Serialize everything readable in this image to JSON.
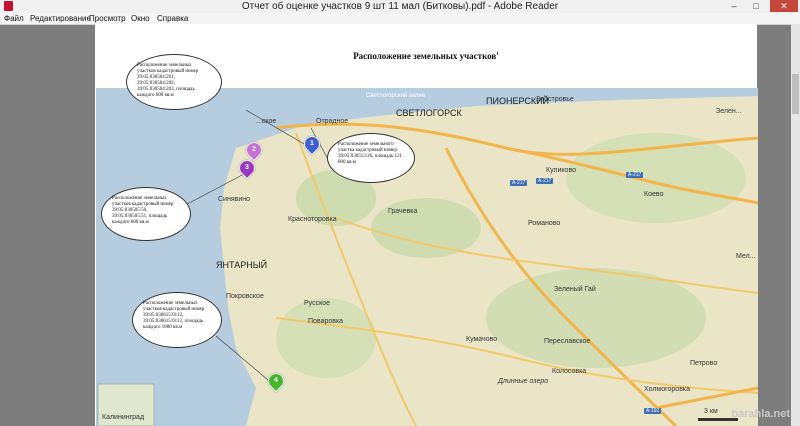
{
  "window": {
    "title": "Отчет об оценке участков 9 шт 11 мал (Битковы).pdf - Adobe Reader",
    "minimize": "–",
    "maximize": "□",
    "close": "✕"
  },
  "menu": [
    "Файл",
    "Редактирование",
    "Просмотр",
    "Окно",
    "Справка"
  ],
  "document": {
    "heading": "Расположение земельных участков",
    "footnote_mark": "1"
  },
  "map": {
    "places": {
      "svetlogorsk": "СВЕТЛОГОРСК",
      "pionersky": "ПИОНЕРСКИЙ",
      "yantarny": "ЯНТАРНЫЙ",
      "kulikovo": "Куликово",
      "koevo": "Коевo",
      "romanovo": "Романово",
      "krasnotorovka": "Красноторовка",
      "grachevka": "Грачевка",
      "sinyavino": "Синявино",
      "pokrovskoe": "Покровское",
      "russkoe": "Русское",
      "povarovka": "Поваровка",
      "zeleny_gay": "Зеленый Гай",
      "kumachovo": "Кумачово",
      "pereslavskoe": "Переславское",
      "kolosovka": "Колосовка",
      "petrovo": "Петрово",
      "kholmogorovka": "Холмогоровка",
      "dlinnoe": "Длинные озеро",
      "zavodskoe": "Заостровье",
      "otradnoe": "Отрадное",
      "primorye": "...ское",
      "kaliningrad": "Калининград",
      "mel": "Мел...",
      "zelen": "Зелен...",
      "scale": "3 км"
    },
    "roads": [
      "A-217",
      "A-217",
      "A-217",
      "A-192"
    ],
    "sea_label": "Светлогорский залив"
  },
  "callouts": {
    "c1": "Расположение земельных участков кадастровый номер 39:05:030504:201, 39:05:030504:202, 39:05:030504:203, площадь каждого 600 кв.м",
    "c2": "Расположение земельного участка кадастровый номер 39:05:030513:26, площадь 121 800 кв.м",
    "c3": "Расположение земельных участков кадастровый номер 39:05:030505:50, 39:05:030505:51, площадь каждого 600 кв.м",
    "c4": "Расположение земельных участков кадастровый номер 39:05:030615:0112, 39:05:030615:0113, площадь каждого 1000 кв.м"
  },
  "pins": [
    "1",
    "2",
    "3",
    "4"
  ],
  "colors": {
    "pin1": "#3b5fd6",
    "pin2": "#c66fd6",
    "pin3": "#9a38c4",
    "pin4": "#43b82c"
  },
  "watermark": "barahla.net"
}
